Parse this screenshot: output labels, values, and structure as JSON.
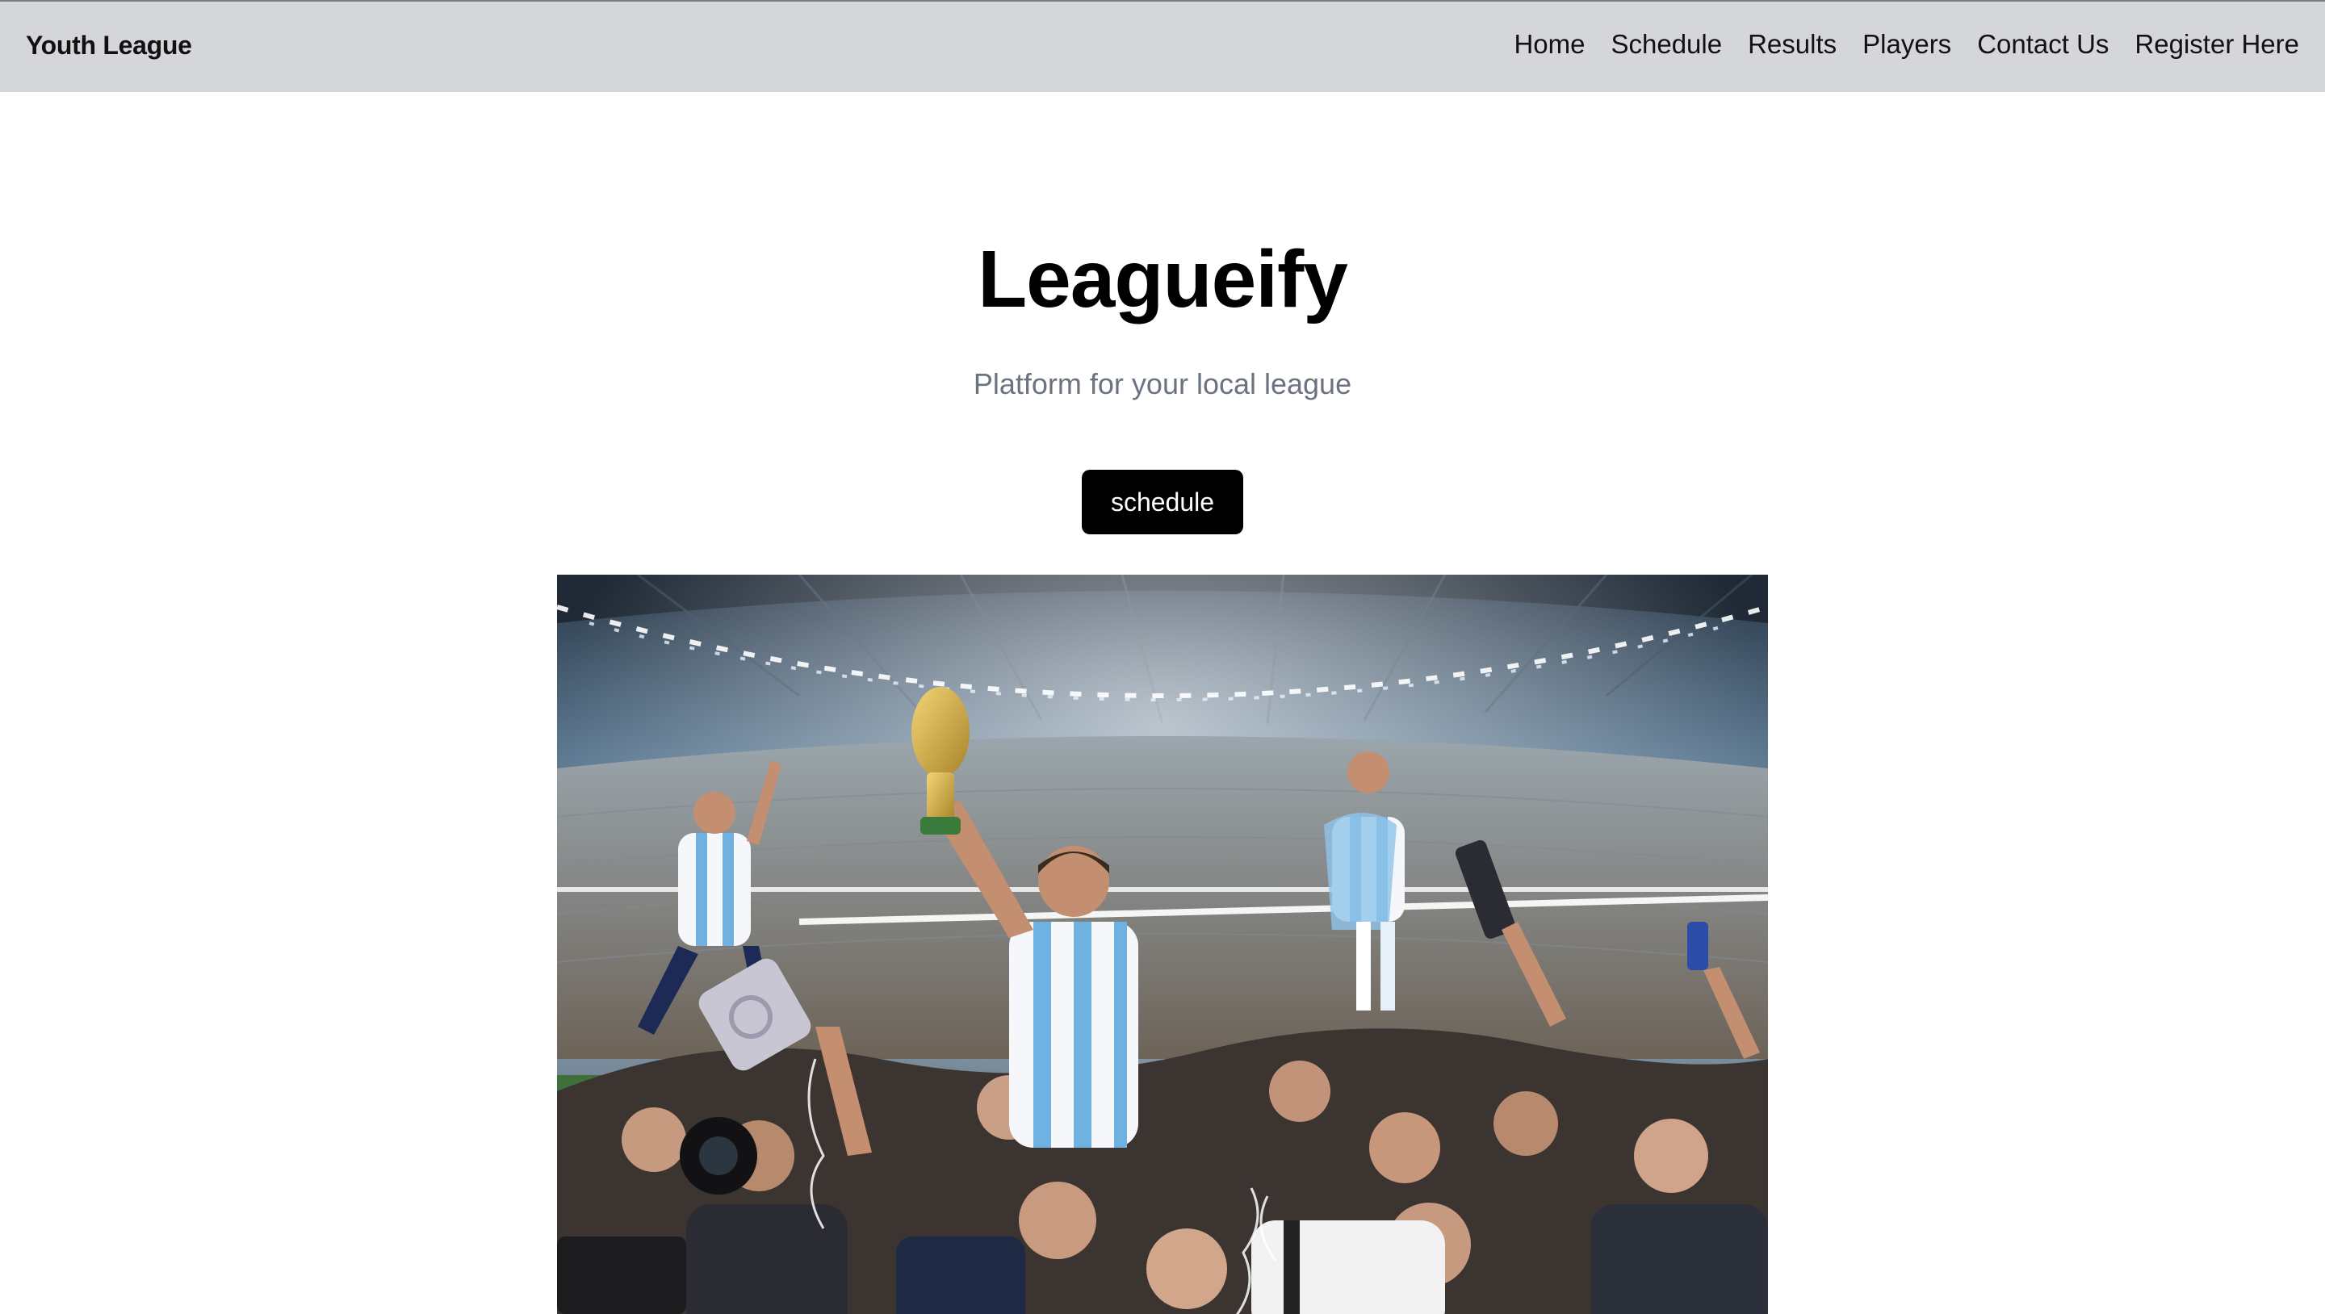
{
  "header": {
    "brand": "Youth League",
    "nav": [
      {
        "label": "Home"
      },
      {
        "label": "Schedule"
      },
      {
        "label": "Results"
      },
      {
        "label": "Players"
      },
      {
        "label": "Contact Us"
      },
      {
        "label": "Register Here"
      }
    ]
  },
  "hero": {
    "title": "Leagueify",
    "subtitle": "Platform for your local league",
    "button_label": "schedule"
  },
  "image": {
    "alt": "Players celebrating with a trophy in a stadium"
  },
  "colors": {
    "header_bg": "#d4d6da",
    "button_bg": "#000000",
    "subtitle": "#6b7280"
  }
}
